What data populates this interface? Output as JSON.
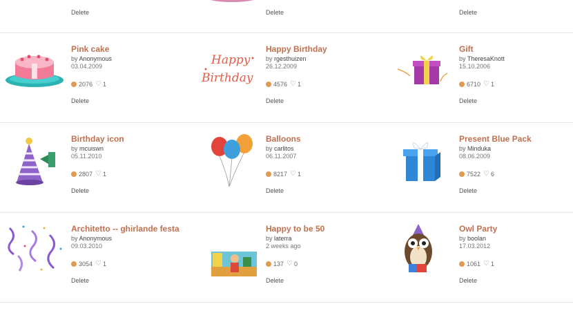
{
  "delete_label": "Delete",
  "colors": {
    "title": "#c0704f",
    "download_dot": "#e09a52",
    "divider": "#e6e6e6"
  },
  "top_row": [
    {
      "delete": "Delete"
    },
    {
      "delete": "Delete"
    },
    {
      "delete": "Delete"
    }
  ],
  "cards": [
    {
      "title": "Pink cake",
      "by": "by",
      "author": "Anonymous",
      "date": "03.04.2009",
      "downloads": "2076",
      "likes": "1",
      "delete": "Delete",
      "thumb": "pink-cake-icon"
    },
    {
      "title": "Happy Birthday",
      "by": "by",
      "author": "rgesthuizen",
      "date": "26.12.2009",
      "downloads": "4576",
      "likes": "1",
      "delete": "Delete",
      "thumb": "happy-birthday-lettering-icon",
      "thumb_text_1": "Happy",
      "thumb_text_2": "Birthday"
    },
    {
      "title": "Gift",
      "by": "by",
      "author": "TheresaKnott",
      "date": "15.10.2006",
      "downloads": "6710",
      "likes": "1",
      "delete": "Delete",
      "thumb": "gift-box-icon"
    },
    {
      "title": "Birthday icon",
      "by": "by",
      "author": "mcuiswn",
      "date": "05.11.2010",
      "downloads": "2807",
      "likes": "1",
      "delete": "Delete",
      "thumb": "party-hat-icon"
    },
    {
      "title": "Balloons",
      "by": "by",
      "author": "carlitos",
      "date": "06.11.2007",
      "downloads": "8217",
      "likes": "1",
      "delete": "Delete",
      "thumb": "balloons-icon"
    },
    {
      "title": "Present Blue Pack",
      "by": "by",
      "author": "Minduka",
      "date": "08.06.2009",
      "downloads": "7522",
      "likes": "6",
      "delete": "Delete",
      "thumb": "blue-present-icon"
    },
    {
      "title": "Architetto -- ghirlande festa",
      "by": "by",
      "author": "Anonymous",
      "date": "09.03.2010",
      "downloads": "3054",
      "likes": "1",
      "delete": "Delete",
      "thumb": "streamers-icon"
    },
    {
      "title": "Happy to be 50",
      "by": "by",
      "author": "laterra",
      "date": "2 weeks ago",
      "downloads": "137",
      "likes": "0",
      "delete": "Delete",
      "thumb": "happy-50-scene-icon"
    },
    {
      "title": "Owl Party",
      "by": "by",
      "author": "boolan",
      "date": "17.03.2012",
      "downloads": "1061",
      "likes": "1",
      "delete": "Delete",
      "thumb": "owl-party-icon"
    }
  ]
}
